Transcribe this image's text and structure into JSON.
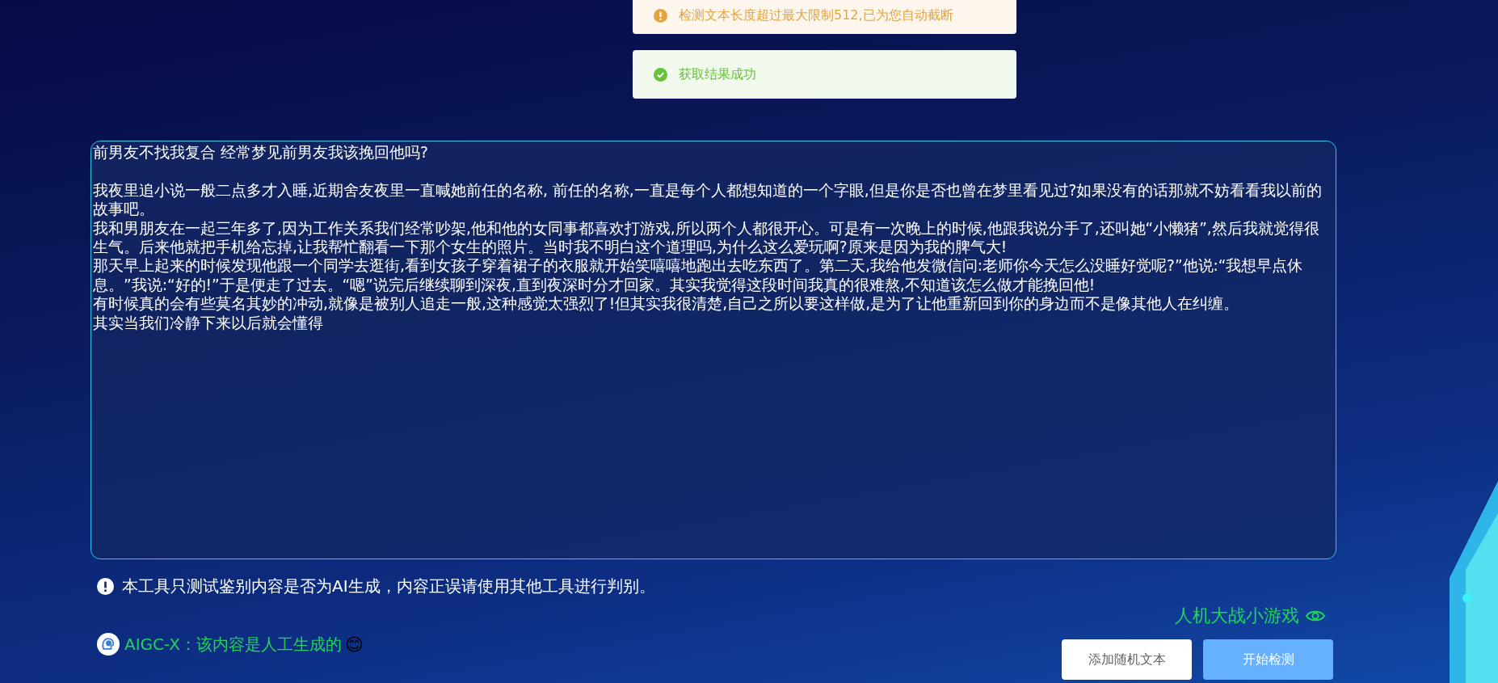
{
  "toasts": [
    {
      "kind": "warning",
      "text": "检测文本长度超过最大限制512,已为您自动截断"
    },
    {
      "kind": "success",
      "text": "获取结果成功"
    }
  ],
  "input": {
    "heading": "前男友不找我复合 经常梦见前男友我该挽回他吗?",
    "paragraphs": [
      "我夜里追小说一般二点多才入睡,近期舍友夜里一直喊她前任的名称, 前任的名称,一直是每个人都想知道的一个字眼,但是你是否也曾在梦里看见过?如果没有的话那就不妨看看我以前的故事吧。",
      "我和男朋友在一起三年多了,因为工作关系我们经常吵架,他和他的女同事都喜欢打游戏,所以两个人都很开心。可是有一次晚上的时候,他跟我说分手了,还叫她“小懒猪”,然后我就觉得很生气。后来他就把手机给忘掉,让我帮忙翻看一下那个女生的照片。当时我不明白这个道理吗,为什么这么爱玩啊?原来是因为我的脾气大!",
      "那天早上起来的时候发现他跟一个同学去逛街,看到女孩子穿着裙子的衣服就开始笑嘻嘻地跑出去吃东西了。第二天,我给他发微信问:老师你今天怎么没睡好觉呢?”他说:“我想早点休息。”我说:“好的!”于是便走了过去。“嗯”说完后继续聊到深夜,直到夜深时分才回家。其实我觉得这段时间我真的很难熬,不知道该怎么做才能挽回他!",
      "有时候真的会有些莫名其妙的冲动,就像是被别人追走一般,这种感觉太强烈了!但其实我很清楚,自己之所以要这样做,是为了让他重新回到你的身边而不是像其他人在纠缠。",
      "其实当我们冷静下来以后就会懂得"
    ]
  },
  "notice": "本工具只测试鉴别内容是否为AI生成，内容正误请使用其他工具进行判别。",
  "game_link": "人机大战小游戏",
  "result": {
    "label": "AIGC-X：",
    "text": "该内容是人工生成的",
    "emoji": "😊"
  },
  "buttons": [
    {
      "kind": "secondary",
      "label": "添加随机文本"
    },
    {
      "kind": "primary",
      "label": "开始检测"
    }
  ]
}
